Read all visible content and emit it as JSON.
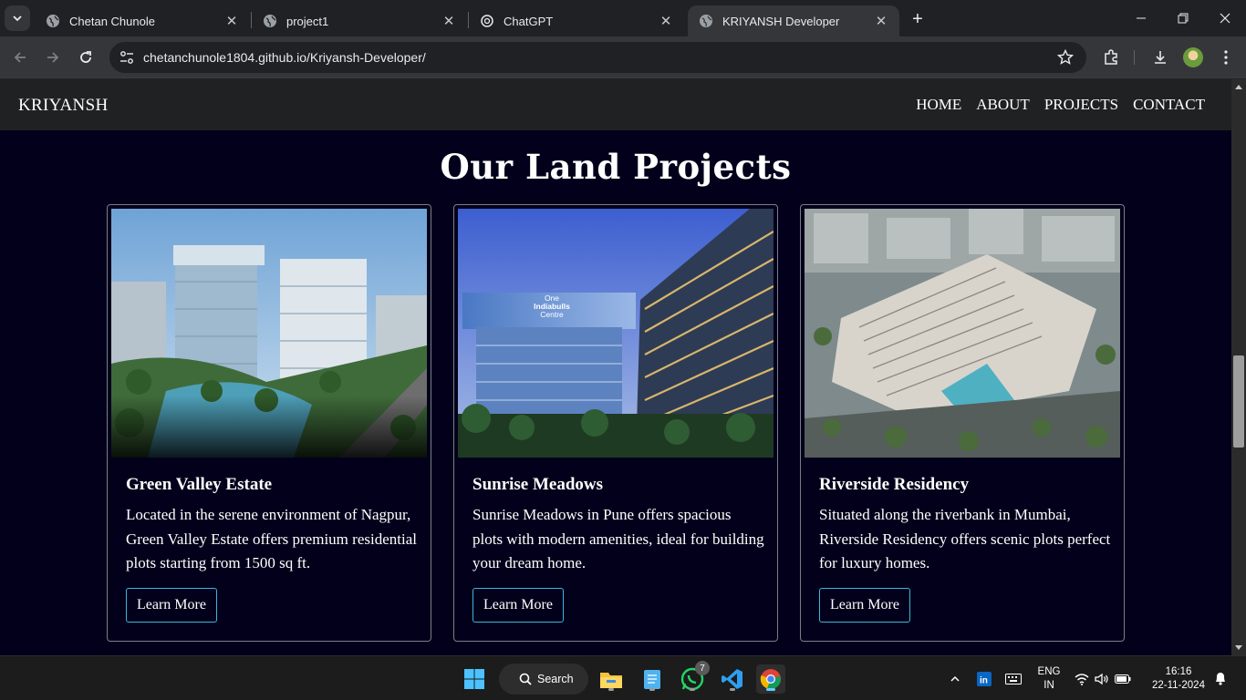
{
  "browser": {
    "tabs": [
      {
        "title": "Chetan Chunole",
        "active": false
      },
      {
        "title": "project1",
        "active": false
      },
      {
        "title": "ChatGPT",
        "active": false
      },
      {
        "title": "KRIYANSH Developer",
        "active": true
      }
    ],
    "url": "chetanchunole1804.github.io/Kriyansh-Developer/"
  },
  "site": {
    "brand": "KRIYANSH",
    "nav": [
      "HOME",
      "ABOUT",
      "PROJECTS",
      "CONTACT"
    ],
    "section_title": "Our Land Projects",
    "projects": [
      {
        "title": "Green Valley Estate",
        "description": "Located in the serene environment of Nagpur, Green Valley Estate offers premium residential plots starting from 1500 sq ft.",
        "button": "Learn More"
      },
      {
        "title": "Sunrise Meadows",
        "description": "Sunrise Meadows in Pune offers spacious plots with modern amenities, ideal for building your dream home.",
        "button": "Learn More",
        "image_sign": "One Indiabulls Centre"
      },
      {
        "title": "Riverside Residency",
        "description": "Situated along the riverbank in Mumbai, Riverside Residency offers scenic plots perfect for luxury homes.",
        "button": "Learn More"
      }
    ]
  },
  "taskbar": {
    "search_label": "Search",
    "whatsapp_badge": "7",
    "lang_line1": "ENG",
    "lang_line2": "IN",
    "time": "16:16",
    "date": "22-11-2024"
  },
  "colors": {
    "page_bg": "#03001b",
    "nav_bg": "#1f2123",
    "button_border": "#3db5df"
  }
}
